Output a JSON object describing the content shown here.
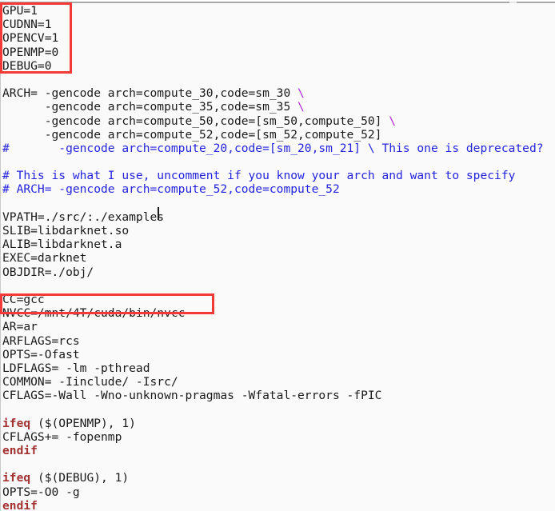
{
  "window": {
    "kind": "text-editor-pane",
    "background_color": "#fbfafa",
    "chrome_bar_color": "#a8a8a8"
  },
  "colors": {
    "text": "#1a1a1a",
    "comment": "#2424e0",
    "continuation": "#b028d8",
    "keyword": "#a33232",
    "annotation_box": "#f43a36",
    "background": "#fbfafa"
  },
  "file": {
    "language": "Makefile",
    "caret_after_text": "VPATH=./src/:./examples"
  },
  "annotations": [
    {
      "name": "build-flags-highlight",
      "label": "",
      "covers": "GPU=1 .. DEBUG=0"
    },
    {
      "name": "nvcc-path-highlight",
      "label": "",
      "covers": "NVCC=/mnt/4T/cuda/bin/nvcc"
    }
  ],
  "code_lines": [
    {
      "id": "l1",
      "segments": [
        {
          "cls": "tok-plain",
          "text": "GPU=1"
        }
      ]
    },
    {
      "id": "l2",
      "segments": [
        {
          "cls": "tok-plain",
          "text": "CUDNN=1"
        }
      ]
    },
    {
      "id": "l3",
      "segments": [
        {
          "cls": "tok-plain",
          "text": "OPENCV=1"
        }
      ]
    },
    {
      "id": "l4",
      "segments": [
        {
          "cls": "tok-plain",
          "text": "OPENMP=0"
        }
      ]
    },
    {
      "id": "l5",
      "segments": [
        {
          "cls": "tok-plain",
          "text": "DEBUG=0"
        }
      ]
    },
    {
      "id": "l6",
      "segments": [
        {
          "cls": "tok-plain",
          "text": ""
        }
      ]
    },
    {
      "id": "l7",
      "segments": [
        {
          "cls": "tok-plain",
          "text": "ARCH= -gencode arch=compute_30,code=sm_30 "
        },
        {
          "cls": "tok-cont",
          "text": "\\"
        }
      ]
    },
    {
      "id": "l8",
      "segments": [
        {
          "cls": "tok-plain",
          "text": "      -gencode arch=compute_35,code=sm_35 "
        },
        {
          "cls": "tok-cont",
          "text": "\\"
        }
      ]
    },
    {
      "id": "l9",
      "segments": [
        {
          "cls": "tok-plain",
          "text": "      -gencode arch=compute_50,code=[sm_50,compute_50] "
        },
        {
          "cls": "tok-cont",
          "text": "\\"
        }
      ]
    },
    {
      "id": "l10",
      "segments": [
        {
          "cls": "tok-plain",
          "text": "      -gencode arch=compute_52,code=[sm_52,compute_52]"
        }
      ]
    },
    {
      "id": "l11",
      "segments": [
        {
          "cls": "tok-comment",
          "text": "#       -gencode arch=compute_20,code=[sm_20,sm_21] \\ This one is deprecated?"
        }
      ]
    },
    {
      "id": "l12",
      "segments": [
        {
          "cls": "tok-plain",
          "text": ""
        }
      ]
    },
    {
      "id": "l13",
      "segments": [
        {
          "cls": "tok-comment",
          "text": "# This is what I use, uncomment if you know your arch and want to specify"
        }
      ]
    },
    {
      "id": "l14",
      "segments": [
        {
          "cls": "tok-comment",
          "text": "# ARCH= -gencode arch=compute_52,code=compute_52"
        }
      ]
    },
    {
      "id": "l15",
      "segments": [
        {
          "cls": "tok-plain",
          "text": ""
        }
      ]
    },
    {
      "id": "l16",
      "segments": [
        {
          "cls": "tok-plain",
          "text": "VPATH=./src/:./examples"
        }
      ]
    },
    {
      "id": "l17",
      "segments": [
        {
          "cls": "tok-plain",
          "text": "SLIB=libdarknet.so"
        }
      ]
    },
    {
      "id": "l18",
      "segments": [
        {
          "cls": "tok-plain",
          "text": "ALIB=libdarknet.a"
        }
      ]
    },
    {
      "id": "l19",
      "segments": [
        {
          "cls": "tok-plain",
          "text": "EXEC=darknet"
        }
      ]
    },
    {
      "id": "l20",
      "segments": [
        {
          "cls": "tok-plain",
          "text": "OBJDIR=./obj/"
        }
      ]
    },
    {
      "id": "l21",
      "segments": [
        {
          "cls": "tok-plain",
          "text": ""
        }
      ]
    },
    {
      "id": "l22",
      "segments": [
        {
          "cls": "tok-plain",
          "text": "CC=gcc"
        }
      ]
    },
    {
      "id": "l23",
      "segments": [
        {
          "cls": "tok-plain",
          "text": "NVCC=/mnt/4T/cuda/bin/nvcc"
        }
      ]
    },
    {
      "id": "l24",
      "segments": [
        {
          "cls": "tok-plain",
          "text": "AR=ar"
        }
      ]
    },
    {
      "id": "l25",
      "segments": [
        {
          "cls": "tok-plain",
          "text": "ARFLAGS=rcs"
        }
      ]
    },
    {
      "id": "l26",
      "segments": [
        {
          "cls": "tok-plain",
          "text": "OPTS=-Ofast"
        }
      ]
    },
    {
      "id": "l27",
      "segments": [
        {
          "cls": "tok-plain",
          "text": "LDFLAGS= -lm -pthread"
        }
      ]
    },
    {
      "id": "l28",
      "segments": [
        {
          "cls": "tok-plain",
          "text": "COMMON= -Iinclude/ -Isrc/"
        }
      ]
    },
    {
      "id": "l29",
      "segments": [
        {
          "cls": "tok-plain",
          "text": "CFLAGS=-Wall -Wno-unknown-pragmas -Wfatal-errors -fPIC"
        }
      ]
    },
    {
      "id": "l30",
      "segments": [
        {
          "cls": "tok-plain",
          "text": ""
        }
      ]
    },
    {
      "id": "l31",
      "segments": [
        {
          "cls": "tok-kw",
          "text": "ifeq"
        },
        {
          "cls": "tok-plain",
          "text": " ($(OPENMP), 1)"
        }
      ]
    },
    {
      "id": "l32",
      "segments": [
        {
          "cls": "tok-plain",
          "text": "CFLAGS+= -fopenmp"
        }
      ]
    },
    {
      "id": "l33",
      "segments": [
        {
          "cls": "tok-kw",
          "text": "endif"
        }
      ]
    },
    {
      "id": "l34",
      "segments": [
        {
          "cls": "tok-plain",
          "text": ""
        }
      ]
    },
    {
      "id": "l35",
      "segments": [
        {
          "cls": "tok-kw",
          "text": "ifeq"
        },
        {
          "cls": "tok-plain",
          "text": " ($(DEBUG), 1)"
        }
      ]
    },
    {
      "id": "l36",
      "segments": [
        {
          "cls": "tok-plain",
          "text": "OPTS=-O0 -g"
        }
      ]
    },
    {
      "id": "l37",
      "segments": [
        {
          "cls": "tok-kw",
          "text": "endif"
        }
      ]
    }
  ]
}
